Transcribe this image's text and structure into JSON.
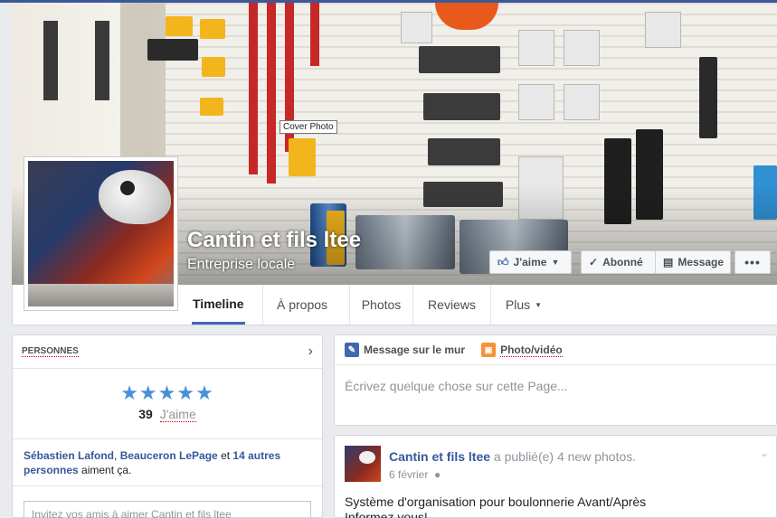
{
  "cover": {
    "tooltip": "Cover Photo",
    "page_name": "Cantin et fils ltee",
    "category": "Entreprise locale"
  },
  "actions": {
    "like": "J'aime",
    "follow": "Abonné",
    "message": "Message",
    "more": "•••"
  },
  "nav": {
    "tabs": [
      "Timeline",
      "À propos",
      "Photos",
      "Reviews",
      "Plus"
    ],
    "active": "Timeline"
  },
  "people": {
    "header": "PERSONNES",
    "stars": "★★★★★",
    "like_count": "39",
    "like_label": "J'aime",
    "friends": {
      "name1": "Sébastien Lafond",
      "sep": ", ",
      "name2": "Beauceron LePage",
      "and": " et ",
      "others": "14 autres personnes",
      "suffix": " aiment ça."
    },
    "invite_placeholder": "Invitez vos amis à aimer Cantin et fils ltee"
  },
  "composer": {
    "status_label": "Message sur le mur",
    "photo_label": "Photo/vidéo",
    "placeholder": "Écrivez quelque chose sur cette Page..."
  },
  "post": {
    "author": "Cantin et fils ltee",
    "action": " a publié(e) 4 new photos.",
    "date": "6 février",
    "line1": "Système d'organisation pour boulonnerie Avant/Après",
    "line2": "Informez vous!"
  },
  "colors": {
    "accent": "#4267b2",
    "link": "#365899",
    "star": "#4a90d9"
  }
}
